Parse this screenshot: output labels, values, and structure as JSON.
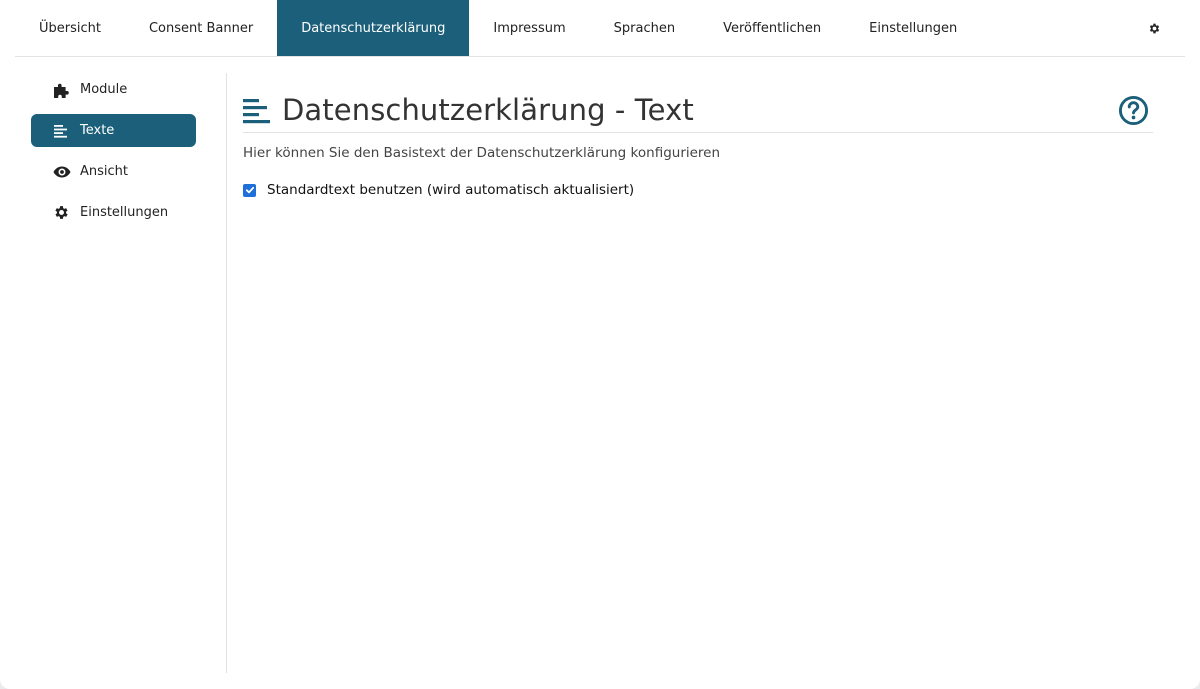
{
  "topnav": {
    "tabs": [
      {
        "label": "Übersicht",
        "active": false
      },
      {
        "label": "Consent Banner",
        "active": false
      },
      {
        "label": "Datenschutzerklärung",
        "active": true
      },
      {
        "label": "Impressum",
        "active": false
      },
      {
        "label": "Sprachen",
        "active": false
      },
      {
        "label": "Veröffentlichen",
        "active": false
      },
      {
        "label": "Einstellungen",
        "active": false
      }
    ],
    "settings_icon": "gear-icon"
  },
  "sidebar": {
    "items": [
      {
        "label": "Module",
        "icon": "puzzle-icon",
        "active": false
      },
      {
        "label": "Texte",
        "icon": "align-left-icon",
        "active": true
      },
      {
        "label": "Ansicht",
        "icon": "eye-icon",
        "active": false
      },
      {
        "label": "Einstellungen",
        "icon": "gear-icon",
        "active": false
      }
    ]
  },
  "main": {
    "title": "Datenschutzerklärung - Text",
    "title_icon": "align-left-icon",
    "help_icon": "question-circle-icon",
    "description": "Hier können Sie den Basistext der Datenschutzerklärung konfigurieren",
    "checkbox": {
      "label": "Standardtext benutzen (wird automatisch aktualisiert)",
      "checked": true
    }
  },
  "colors": {
    "accent": "#1b5f7a",
    "checkbox": "#1e6fd9"
  }
}
